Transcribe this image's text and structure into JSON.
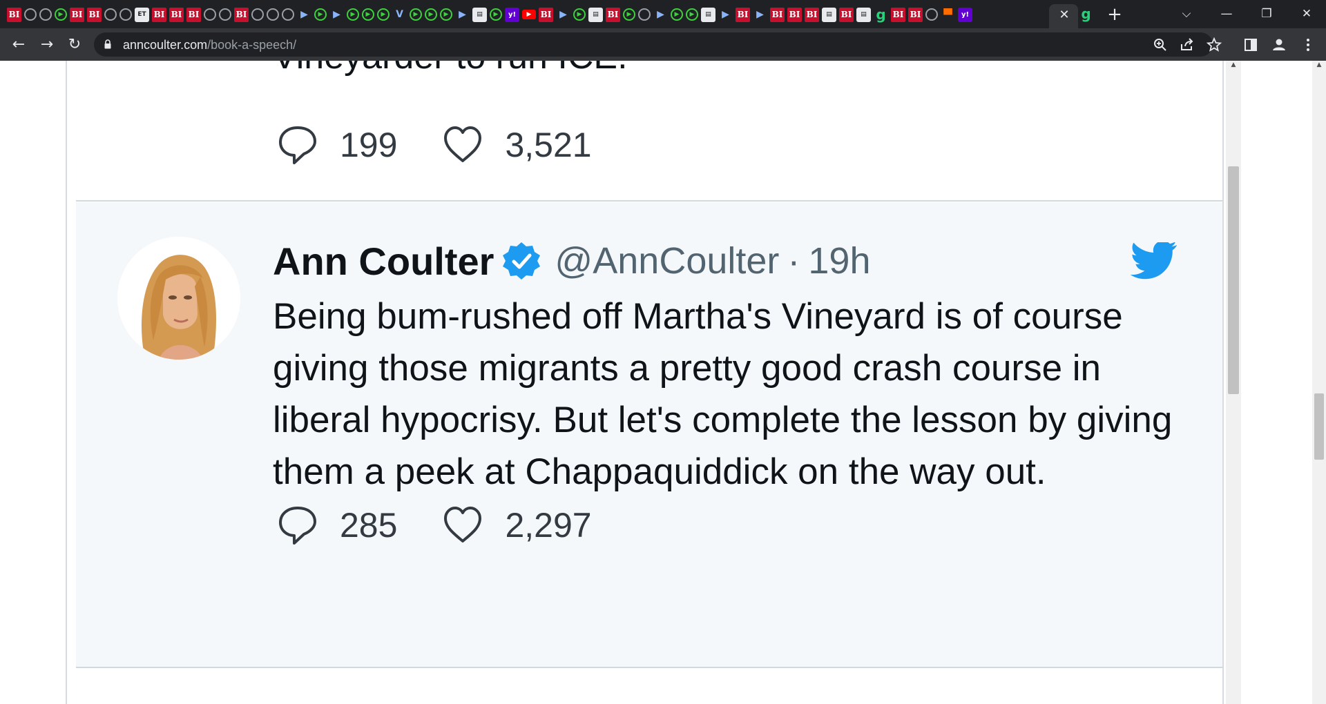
{
  "browser": {
    "tab_favicons": [
      "bi",
      "globe",
      "globe",
      "play",
      "bi",
      "bi",
      "globe",
      "globe",
      "et",
      "bi",
      "bi",
      "bi",
      "globe",
      "globe",
      "bi",
      "globe",
      "globe",
      "globe",
      "flag",
      "play",
      "flag",
      "play",
      "play",
      "play",
      "v",
      "play",
      "play",
      "play",
      "flag",
      "misc",
      "play",
      "yahoo",
      "yt",
      "bi",
      "flag",
      "play",
      "misc",
      "bi",
      "play",
      "globe",
      "flag",
      "play",
      "play",
      "misc",
      "flag",
      "bi",
      "flag",
      "bi",
      "bi",
      "bi",
      "misc",
      "bi",
      "misc",
      "g",
      "bi",
      "bi",
      "globe",
      "bm",
      "yahoo"
    ],
    "active_tab_favicon": "g",
    "tab_labels": {
      "bi": "BI",
      "et": "ET",
      "v": "V",
      "flag": "▶",
      "play": "▶",
      "yahoo": "y!",
      "yt": "▶",
      "g": "g",
      "bm": "▀",
      "misc": "▤",
      "globe": ""
    },
    "active_tab_close": "✕",
    "new_tab": "+",
    "window_controls": {
      "tab_search": "⌵",
      "minimize": "—",
      "restore": "❐",
      "close": "✕"
    },
    "nav": {
      "back": "←",
      "forward": "→",
      "reload": "↻"
    },
    "url_host": "anncoulter.com",
    "url_path": "/book-a-speech/",
    "icons": {
      "lock": "lock-icon",
      "zoom": "zoom-icon",
      "share": "share-icon",
      "bookmark": "star-icon",
      "side_panel": "side-panel-icon",
      "profile": "profile-icon",
      "menu": "kebab-menu-icon"
    }
  },
  "previous_tweet": {
    "text_fragment": "Vineyarder to run ICE.",
    "replies": "199",
    "likes": "3,521"
  },
  "tweet": {
    "author": "Ann Coulter",
    "handle": "@AnnCoulter",
    "separator": "·",
    "time": "19h",
    "verified": true,
    "text": "Being bum-rushed off Martha's Vineyard is of course giving those migrants a pretty good crash course in liberal hypocrisy. But let's complete the lesson by giving them a peek at Chappaquiddick on the way out.",
    "replies": "285",
    "likes": "2,297"
  },
  "colors": {
    "tab_strip": "#202124",
    "toolbar": "#35363a",
    "twitter_blue": "#1d9bf0",
    "tweet_highlight_bg": "#f5f8fa",
    "text": "#0f1419",
    "muted": "#536471"
  }
}
